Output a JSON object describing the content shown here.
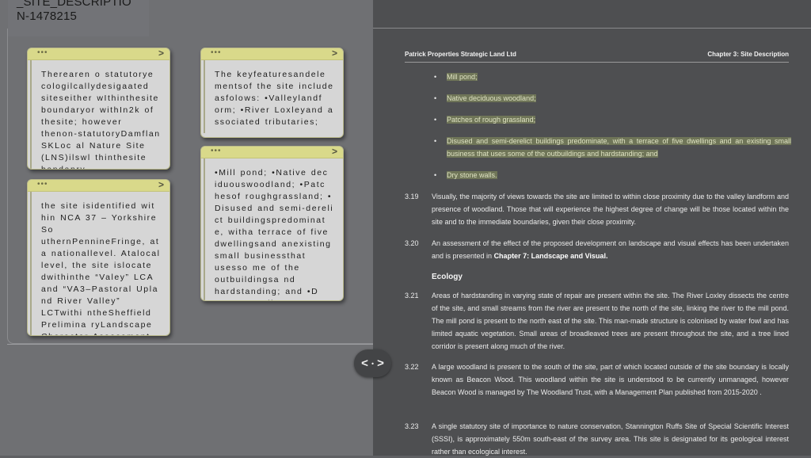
{
  "canvas": {
    "title_line1": "_SITE_DESCRIPTIO",
    "title_line2": "N-1478215"
  },
  "notes": [
    {
      "id": "note-1",
      "dots": "•••",
      "chevron": ">",
      "text": "Therearen o statutorye cologilcallydesigaated siteseither wIthinthesite boundaryor withIn2k of thesite; however thenon-statutoryDamflan SKLoc al Nature Site (LNS)ilswl thinthesite bandanry."
    },
    {
      "id": "note-2",
      "dots": "•••",
      "chevron": ">",
      "text": "the site isidentified wit hin NCA 37 – Yorkshire So uthernPennineFringe, at a nationallevel. Atalocal level, the site islocate dwithinthe “Valey” LCA and “VA3–Pastoral Upla nd River Valley” LCTwithi ntheSheffield Prelimina ryLandscape Character Assessment."
    },
    {
      "id": "note-3",
      "dots": "•••",
      "chevron": ">",
      "text": "The keyfeaturesandele mentsof the site include asfolows: •Valleylandf orm; •River Loxleyand a ssociated tributaries;"
    },
    {
      "id": "note-4",
      "dots": "•••",
      "chevron": ">",
      "text": "•Mill pond; •Native dec iduouswoodland; •Patc hesof roughgrassland; • Disused and semi-dereli ct buildingspredominat e, witha terrace of five dwellingsand anexisting small businessthat usesso me of the outbuildingsa nd hardstanding; and •D rystone walls."
    }
  ],
  "splitter": {
    "left": "<",
    "dot": "•",
    "right": ">"
  },
  "document": {
    "header_left": "Patrick Properties Strategic Land Ltd",
    "header_right": "Chapter 3: Site Description",
    "bullets": [
      {
        "mark": "•",
        "text": "Mill pond;"
      },
      {
        "mark": "•",
        "text": "Native deciduous woodland;"
      },
      {
        "mark": "•",
        "text": "Patches of rough grassland;"
      },
      {
        "mark": "•",
        "text": "Disused and semi-derelict buildings predominate, with a terrace of five dwellings and an existing small business that uses some of the outbuildings and hardstanding; and"
      },
      {
        "mark": "•",
        "text": "Dry stone walls."
      }
    ],
    "paragraphs": [
      {
        "num": "3.19",
        "text": "Visually, the majority of views towards the site are limited to within close proximity due to the valley landform and presence of woodland. Those that will experience the highest degree of change will be those located within the site and to the immediate boundaries, given their close proximity."
      },
      {
        "num": "3.20",
        "text": "An assessment of the effect of the proposed development on landscape and visual effects has been undertaken and is presented in ",
        "bold": "Chapter 7: Landscape and Visual."
      },
      {
        "num": "3.21",
        "text": "Areas of hardstanding in varying state of repair are present within the site. The River Loxley dissects the centre of the site, and small streams from the river are present to the north of the site, linking the river to the mill pond. The mill pond is present to the north east of the site. This man-made structure is colonised by water fowl and has limited aquatic vegetation.  Small areas of broadleaved trees are present throughout the site, and a tree lined corridor is present along much of the river."
      },
      {
        "num": "3.22",
        "text": "A large woodland is present to the south of the site, part of which located outside of the site boundary is locally known as Beacon Wood. This woodland within the site is understood to be currently unmanaged, however Beacon Wood is managed by The Woodland Trust, with a Management Plan published from 2015-2020 ."
      },
      {
        "num": "3.23",
        "text": "A single statutory site of importance to nature conservation, Stannington Ruffs Site of Special Scientific Interest (SSSI), is  approximately 550m south-east of the survey area.  This site is designated for its geological interest rather than ecological interest."
      }
    ],
    "section_ecology": "Ecology"
  }
}
